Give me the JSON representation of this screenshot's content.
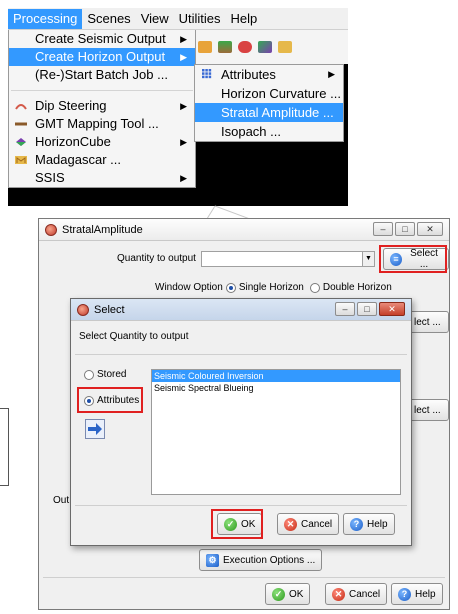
{
  "menubar": {
    "items": [
      "Processing",
      "Scenes",
      "View",
      "Utilities",
      "Help"
    ],
    "active_index": 0
  },
  "processing_menu": {
    "items": [
      {
        "label": "Create Seismic Output",
        "submenu": true
      },
      {
        "label": "Create Horizon Output",
        "submenu": true,
        "highlighted": true
      },
      {
        "label": "(Re-)Start Batch Job ...",
        "submenu": false
      },
      {
        "label": "Dip Steering",
        "submenu": true,
        "icon": "dip-steering-icon"
      },
      {
        "label": "GMT Mapping Tool ...",
        "submenu": false,
        "icon": "gmt-icon"
      },
      {
        "label": "HorizonCube",
        "submenu": true,
        "icon": "horizoncube-icon"
      },
      {
        "label": "Madagascar ...",
        "submenu": false,
        "icon": "madagascar-icon"
      },
      {
        "label": "SSIS",
        "submenu": true
      }
    ]
  },
  "horizon_submenu": {
    "items": [
      {
        "label": "Attributes",
        "submenu": true,
        "icon": "grid-icon"
      },
      {
        "label": "Horizon Curvature ...",
        "submenu": false
      },
      {
        "label": "Stratal Amplitude ...",
        "submenu": false,
        "highlighted": true
      },
      {
        "label": "Isopach ...",
        "submenu": false
      }
    ]
  },
  "main_dialog": {
    "title": "StratalAmplitude",
    "quantity_label": "Quantity to output",
    "quantity_value": "",
    "select_button": "Select ...",
    "window_option_label": "Window Option",
    "single_horizon": "Single Horizon",
    "double_horizon": "Double Horizon",
    "select_partial_1": "lect ...",
    "select_partial_2": "lect ...",
    "obscured_text": "Out",
    "execution_options": "Execution Options ...",
    "ok": "OK",
    "cancel": "Cancel",
    "help": "Help"
  },
  "select_dialog": {
    "title": "Select",
    "heading": "Select Quantity to output",
    "stored": "Stored",
    "attributes": "Attributes",
    "list_items": [
      "Seismic Coloured Inversion",
      "Seismic Spectral Blueing"
    ],
    "selected_index": 0,
    "ok": "OK",
    "cancel": "Cancel",
    "help": "Help"
  },
  "colors": {
    "menu_highlight": "#3399ff",
    "callout_red": "#e02020",
    "dialog_bg": "#f0f0f0"
  }
}
